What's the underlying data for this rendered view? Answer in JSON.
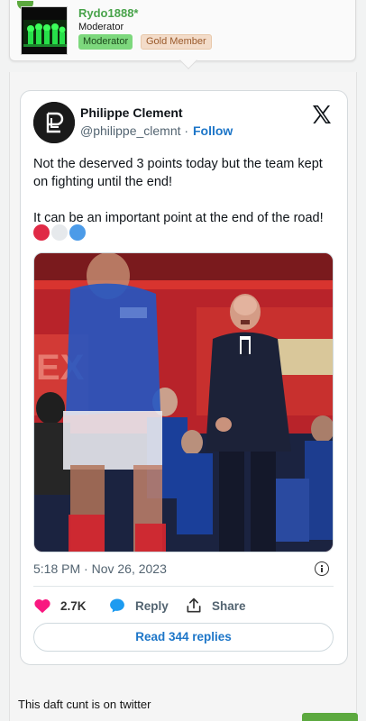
{
  "author": {
    "username": "Rydo1888*",
    "title": "Moderator",
    "badges": [
      "Moderator",
      "Gold Member"
    ]
  },
  "tweet": {
    "name": "Philippe Clement",
    "handle": "@philippe_clemnt",
    "separator": "·",
    "follow_label": "Follow",
    "text_line1": "Not the deserved 3 points today but the team kept on fighting until the end!",
    "text_line2": "It can be an important point at the end of the road!",
    "emoji_colors": [
      "#e02a46",
      "#e6e9ec",
      "#4c9be8"
    ],
    "timestamp": "5:18 PM · Nov 26, 2023",
    "likes": "2.7K",
    "reply_label": "Reply",
    "share_label": "Share",
    "read_replies": "Read 344 replies"
  },
  "post": {
    "caption": "This daft cunt is on twitter"
  },
  "colors": {
    "link_blue": "#1d76c8",
    "like_pink": "#f91880",
    "username_green": "#48a34a"
  }
}
